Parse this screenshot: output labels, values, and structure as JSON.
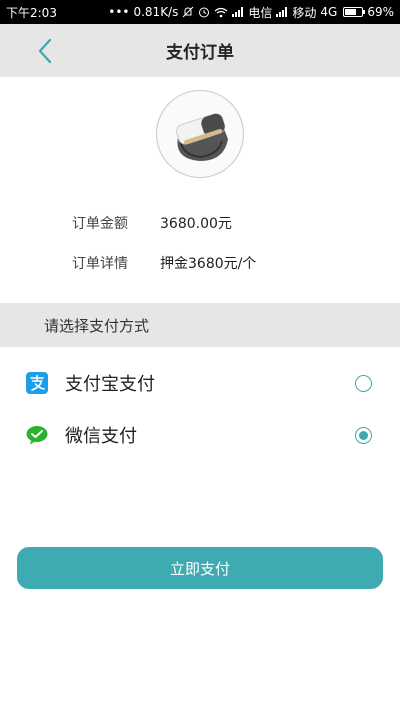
{
  "statusbar": {
    "time": "下午2:03",
    "speed": "0.81K/s",
    "carrier1": "电信",
    "carrier2": "移动",
    "network": "4G",
    "battery": "69%",
    "battery_level": 0.69
  },
  "header": {
    "title": "支付订单",
    "back_icon": "chevron-left-icon"
  },
  "order": {
    "amount_label": "订单金额",
    "amount_value": "3680.00元",
    "detail_label": "订单详情",
    "detail_value": "押金3680元/个"
  },
  "payment": {
    "section_title": "请选择支付方式",
    "options": [
      {
        "label": "支付宝支付",
        "icon": "alipay-icon",
        "selected": false
      },
      {
        "label": "微信支付",
        "icon": "wechat-icon",
        "selected": true
      }
    ]
  },
  "actions": {
    "pay_label": "立即支付"
  },
  "colors": {
    "accent": "#3eaab2",
    "alipay": "#1a9fe8",
    "wechat": "#2bb12e",
    "header_bg": "#e6e6e6"
  }
}
